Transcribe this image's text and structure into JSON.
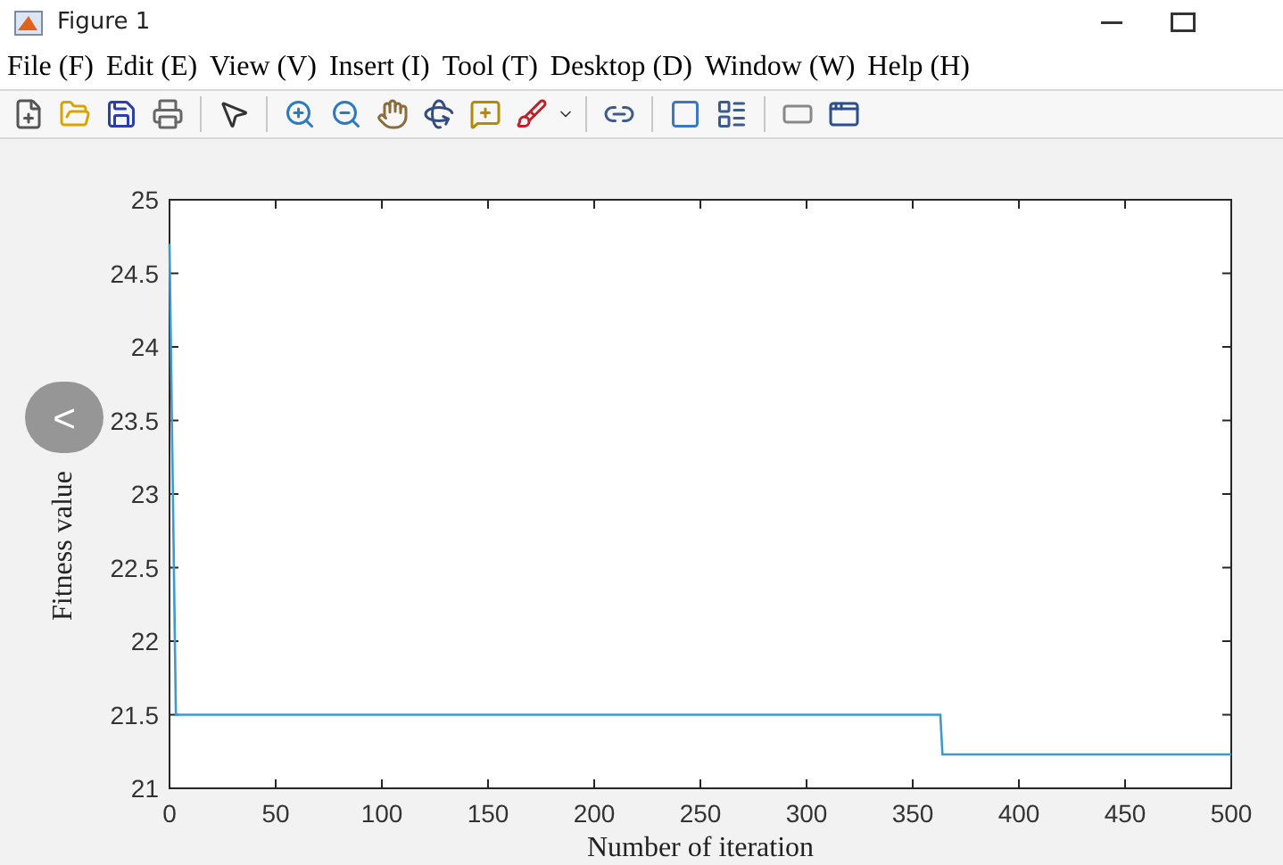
{
  "window": {
    "title": "Figure 1"
  },
  "menu": [
    "File (F)",
    "Edit (E)",
    "View (V)",
    "Insert (I)",
    "Tool (T)",
    "Desktop (D)",
    "Window (W)",
    "Help (H)"
  ],
  "figure": {
    "chart_data": {
      "type": "line",
      "xlabel": "Number of iteration",
      "ylabel": "Fitness value",
      "x": [
        0,
        3,
        363,
        364,
        500
      ],
      "series": [
        {
          "color": "#3d9ad1",
          "values": [
            24.7,
            21.5,
            21.5,
            21.23,
            21.23
          ]
        }
      ],
      "xlim": [
        0,
        500
      ],
      "ylim": [
        21,
        25
      ],
      "xticks": [
        0,
        50,
        100,
        150,
        200,
        250,
        300,
        350,
        400,
        450,
        500
      ],
      "yticks": [
        {
          "value": 21,
          "label": "21"
        },
        {
          "value": 21.5,
          "label": "21.5"
        },
        {
          "value": 22,
          "label": "22"
        },
        {
          "value": 22.5,
          "label": "22.5"
        },
        {
          "value": 23,
          "label": "23"
        },
        {
          "value": 23.5,
          "label": "23.5"
        },
        {
          "value": 24,
          "label": "24"
        },
        {
          "value": 24.5,
          "label": "24.5"
        },
        {
          "value": 25,
          "label": "25"
        }
      ]
    }
  },
  "overlay_button": {
    "label": "<"
  }
}
